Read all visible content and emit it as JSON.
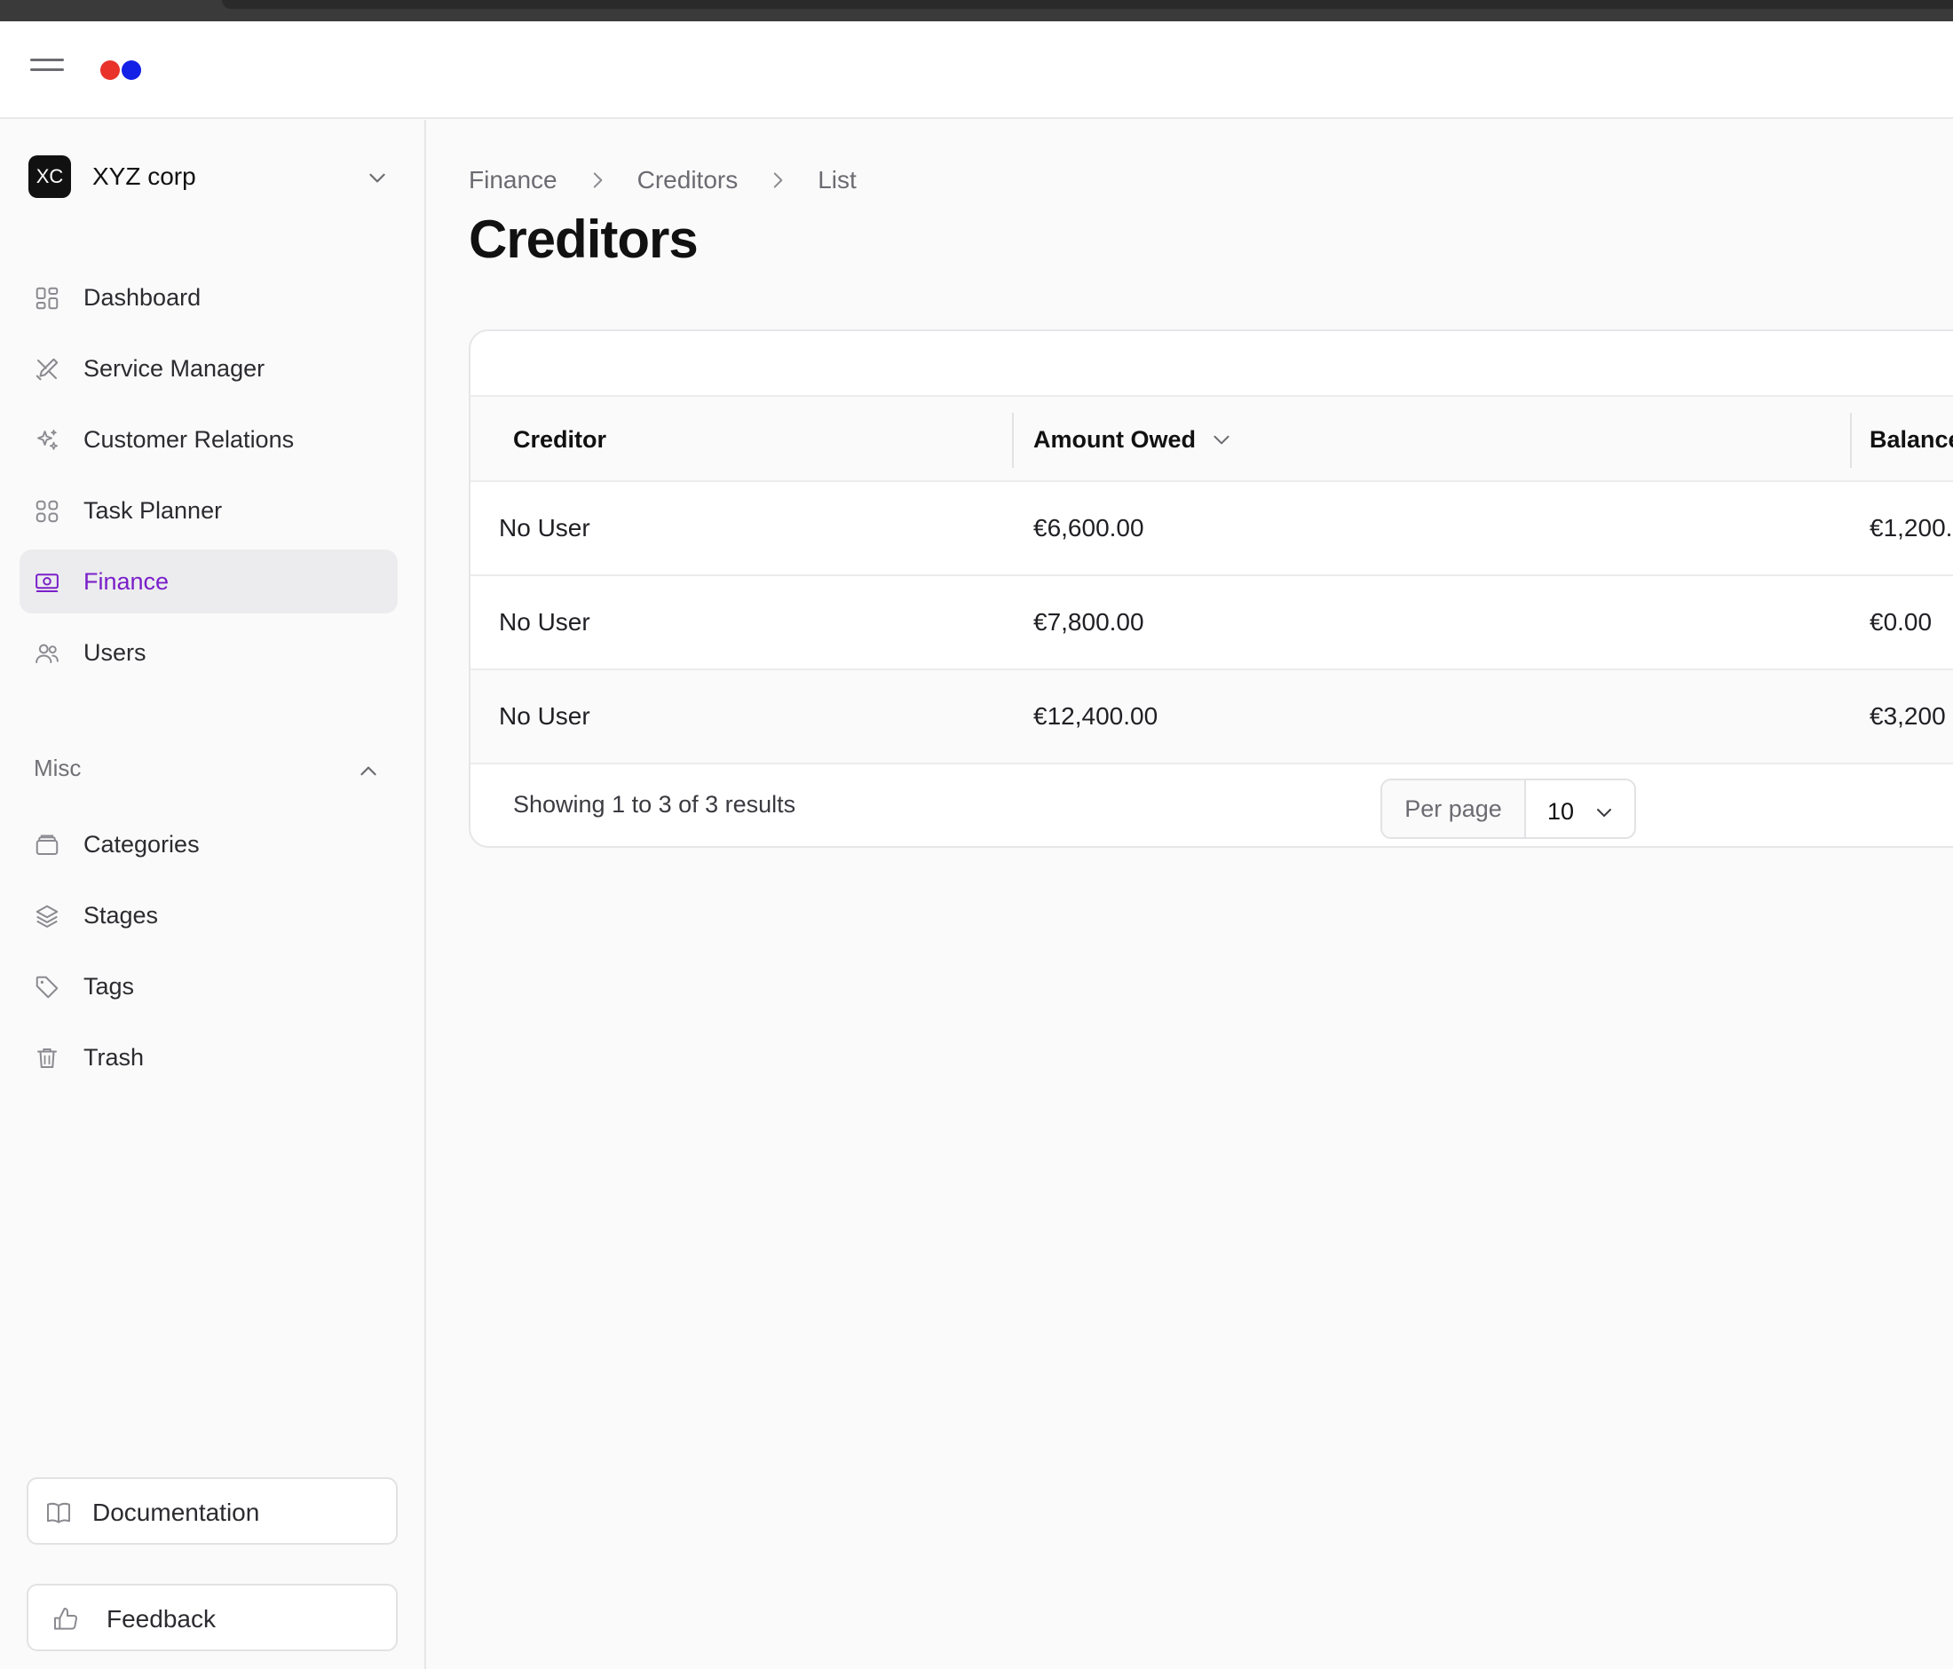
{
  "app": {
    "logo_colors": [
      "#e8322a",
      "#1320e6"
    ]
  },
  "org": {
    "initials": "XC",
    "name": "XYZ corp"
  },
  "nav": {
    "items": [
      {
        "label": "Dashboard",
        "icon": "grid-icon"
      },
      {
        "label": "Service Manager",
        "icon": "tools-icon"
      },
      {
        "label": "Customer Relations",
        "icon": "sparkles-icon"
      },
      {
        "label": "Task Planner",
        "icon": "apps-icon"
      },
      {
        "label": "Finance",
        "icon": "banknote-icon",
        "active": true
      },
      {
        "label": "Users",
        "icon": "users-icon"
      }
    ],
    "misc_label": "Misc",
    "misc_items": [
      {
        "label": "Categories",
        "icon": "folder-icon"
      },
      {
        "label": "Stages",
        "icon": "layers-icon"
      },
      {
        "label": "Tags",
        "icon": "tag-icon"
      },
      {
        "label": "Trash",
        "icon": "trash-icon"
      }
    ],
    "documentation_label": "Documentation",
    "feedback_label": "Feedback"
  },
  "breadcrumb": [
    "Finance",
    "Creditors",
    "List"
  ],
  "page_title": "Creditors",
  "table": {
    "columns": [
      "Creditor",
      "Amount Owed",
      "Balance"
    ],
    "rows": [
      {
        "creditor": "No User",
        "amount": "€6,600.00",
        "balance": "€1,200."
      },
      {
        "creditor": "No User",
        "amount": "€7,800.00",
        "balance": "€0.00"
      },
      {
        "creditor": "No User",
        "amount": "€12,400.00",
        "balance": "€3,200"
      }
    ],
    "summary": "Showing 1 to 3 of 3 results",
    "per_page_label": "Per page",
    "per_page_value": "10"
  },
  "colors": {
    "accent": "#7a1fc9",
    "active_bg": "#ececee"
  }
}
